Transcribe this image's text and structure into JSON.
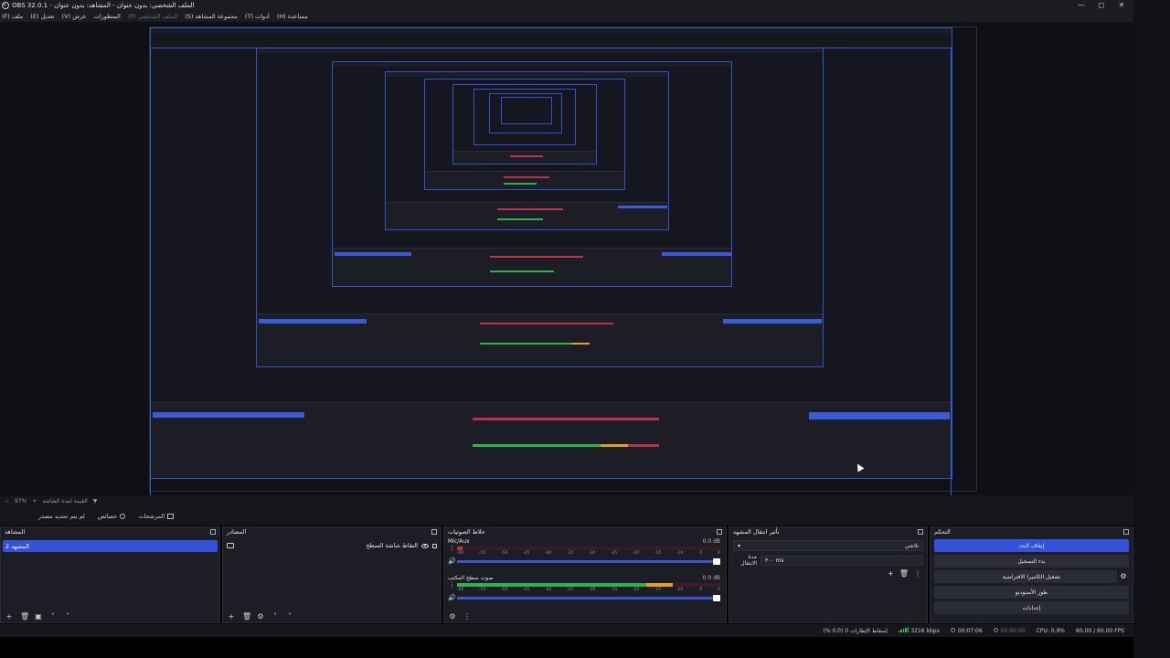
{
  "window": {
    "title": "OBS 32.0.1 - الملف الشخصي: بدون عنوان - المشاهد: بدون عنوان",
    "minimize": "—",
    "maximize": "◻",
    "close": "✕"
  },
  "menu": [
    {
      "label": "ملف (F)",
      "enabled": true
    },
    {
      "label": "تعديل (E)",
      "enabled": true
    },
    {
      "label": "عرض (V)",
      "enabled": true
    },
    {
      "label": "المنظورات",
      "enabled": true
    },
    {
      "label": "الملف الشخصي (P)",
      "enabled": false
    },
    {
      "label": "مجموعة المشاهد (S)",
      "enabled": true
    },
    {
      "label": "أدوات (T)",
      "enabled": true
    },
    {
      "label": "مساعدة (H)",
      "enabled": true
    }
  ],
  "subbar": {
    "zoom": "97%",
    "label": "القيمة لمدة الشاشة",
    "arrow": "▼"
  },
  "toolbar": {
    "no_source": "لم يتم تحديد مصدر",
    "filters": "المرشحات",
    "properties": "خصائص"
  },
  "scenes": {
    "title": "المشاهد",
    "items": [
      "المشهد 2"
    ]
  },
  "sources": {
    "title": "المصادر",
    "items": [
      {
        "label": "التقاط شاشة السطح"
      }
    ]
  },
  "mixer": {
    "title": "خلاط الصوتيات",
    "scale": [
      "-60",
      "-55",
      "-50",
      "-45",
      "-40",
      "-35",
      "-30",
      "-25",
      "-20",
      "-15",
      "-10",
      "-5",
      "0"
    ],
    "channels": [
      {
        "name": "Mic/Aux",
        "db": "0.0 dB",
        "level": 0.02
      },
      {
        "name": "صوت سطح المكتب",
        "db": "0.0 dB",
        "level": 0.82
      }
    ]
  },
  "transitions": {
    "title": "تأثير انتقال المشهد",
    "selected": "تلاشي",
    "duration_label": "مدة الانتقال",
    "duration_value": "۳۰۰ ms"
  },
  "controls": {
    "title": "التحكم",
    "buttons": [
      {
        "label": "إيقاف البث",
        "active": true
      },
      {
        "label": "بدء التسجيل",
        "active": false
      },
      {
        "label": "تشغيل الكاميرا الافتراضية",
        "active": false
      },
      {
        "label": "طور الأستوديو",
        "active": false
      },
      {
        "label": "إعدادات",
        "active": false
      }
    ]
  },
  "status": {
    "dropped": "إسقاط الإطارات 0 (0.0 %)",
    "bitrate": "3216 kbps",
    "stream_time": "00:07:06",
    "rec_time": "00:00:00",
    "cpu": "CPU: 0.9%",
    "fps": "60.00 / 60.00 FPS"
  },
  "colors": {
    "accent": "#3553d8",
    "meter_green": "#2db34a",
    "meter_yellow": "#e0a020",
    "meter_red": "#c0304a",
    "bitrate_ok": "#38c75a"
  }
}
